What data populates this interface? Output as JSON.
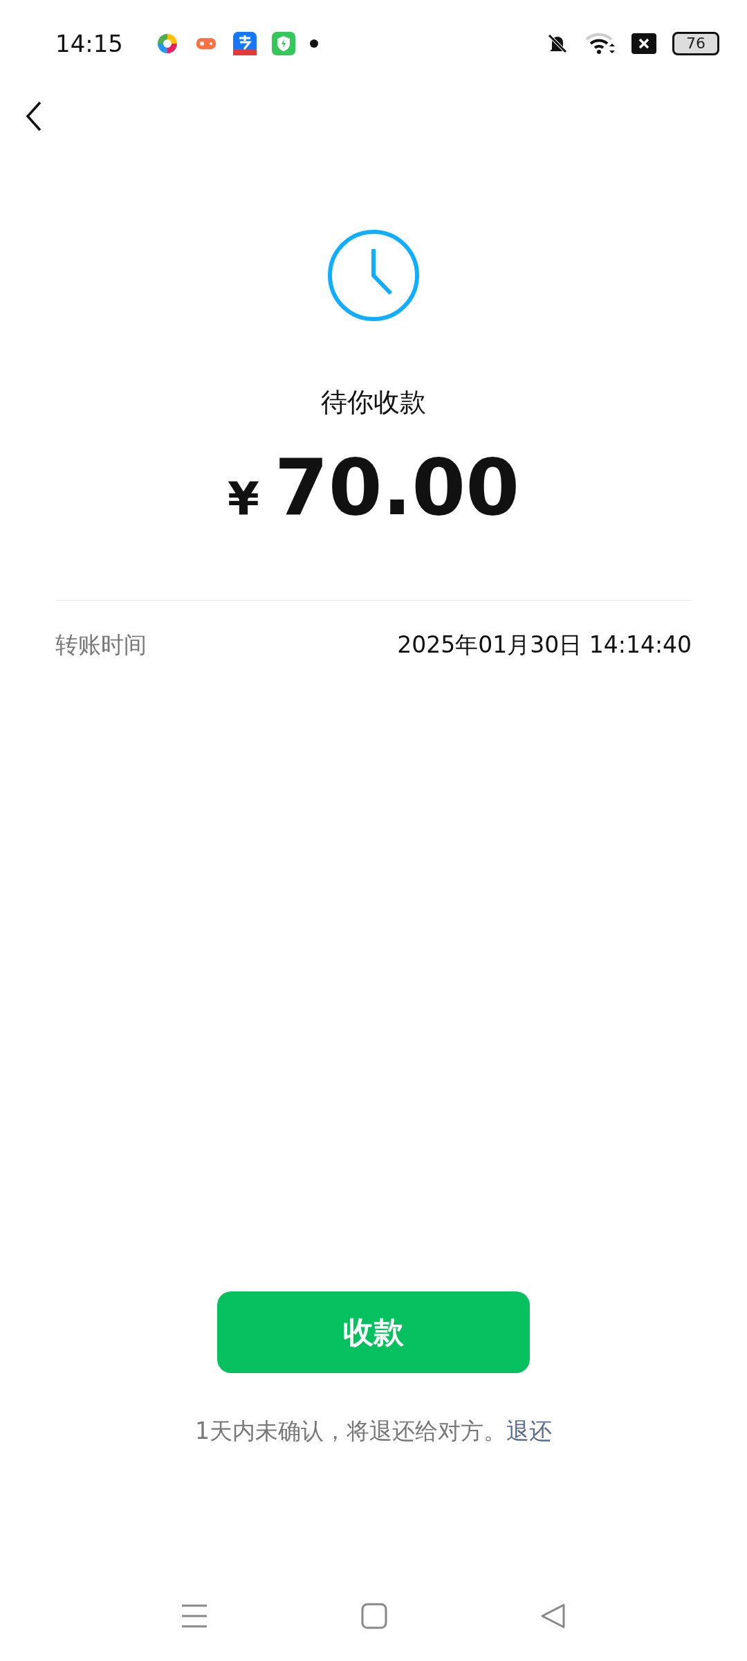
{
  "status_bar": {
    "time": "14:15",
    "battery": "76"
  },
  "status": "待你收款",
  "amount": {
    "currency": "¥",
    "value": "70.00"
  },
  "details": [
    {
      "label": "转账时间",
      "value": "2025年01月30日 14:14:40"
    }
  ],
  "button": "收款",
  "note": {
    "text": "1天内未确认，将退还给对方。",
    "link": "退还"
  }
}
